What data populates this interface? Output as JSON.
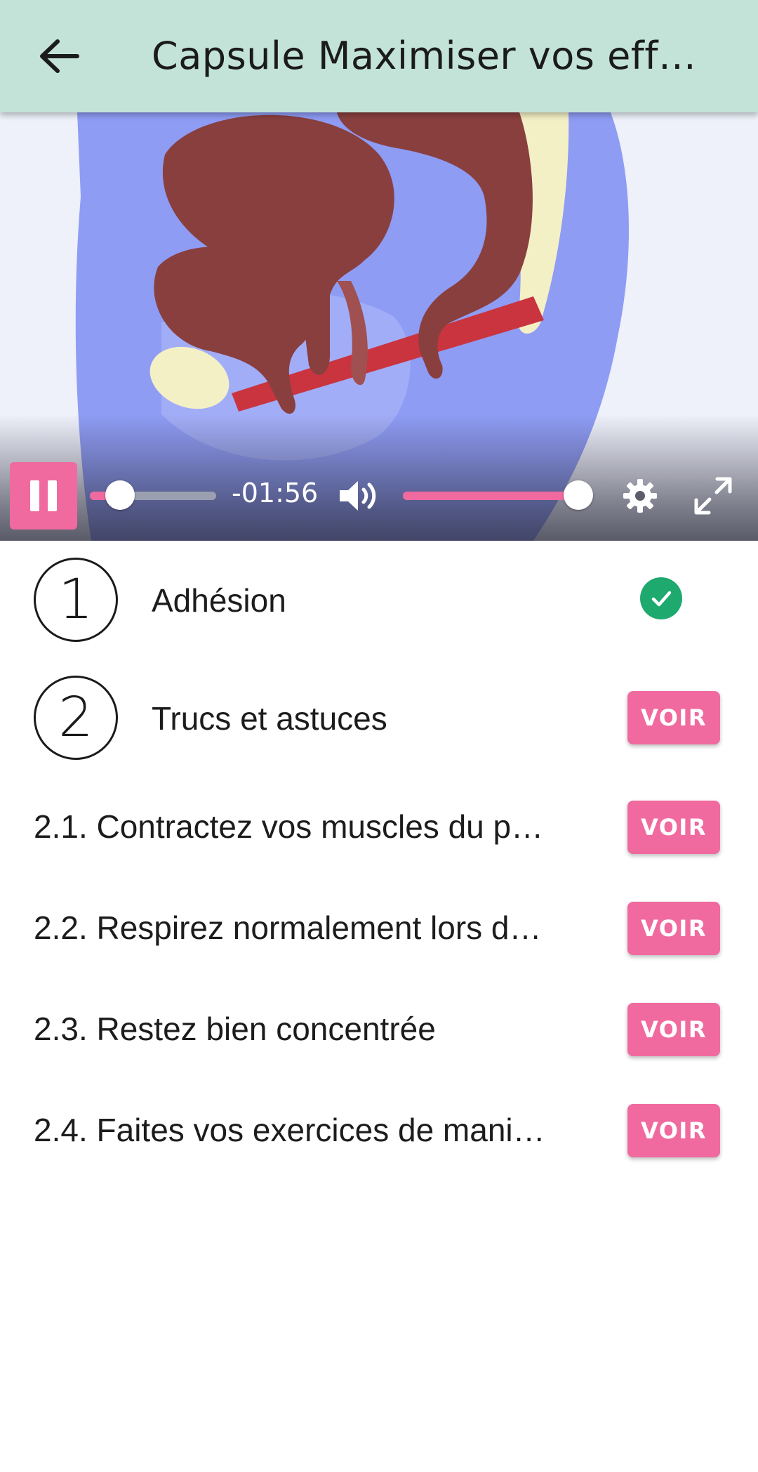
{
  "appbar": {
    "title": "Capsule Maximiser vos eff…",
    "back_icon": "arrow-left-icon",
    "background": "#c3e3d9"
  },
  "player": {
    "state": "playing",
    "time_remaining": "-01:56",
    "progress_fraction": 0.24,
    "volume_fraction": 1.0,
    "accent": "#f06a9f",
    "icons": {
      "pause": "pause-icon",
      "volume": "volume-high-icon",
      "settings": "gear-icon",
      "fullscreen": "expand-icon"
    }
  },
  "chapters": [
    {
      "number": "1",
      "title": "Adhésion",
      "completed": true,
      "status_icon": "check-circle-icon",
      "status_color": "#1ea96e"
    },
    {
      "number": "2",
      "title": "Trucs et astuces",
      "completed": false,
      "button_label": "VOIR"
    }
  ],
  "subitems": [
    {
      "label": "2.1. Contractez vos muscles du p…",
      "button_label": "VOIR"
    },
    {
      "label": "2.2. Respirez normalement lors d…",
      "button_label": "VOIR"
    },
    {
      "label": "2.3. Restez bien concentrée",
      "button_label": "VOIR"
    },
    {
      "label": "2.4. Faites vos exercices de mani…",
      "button_label": "VOIR"
    }
  ]
}
